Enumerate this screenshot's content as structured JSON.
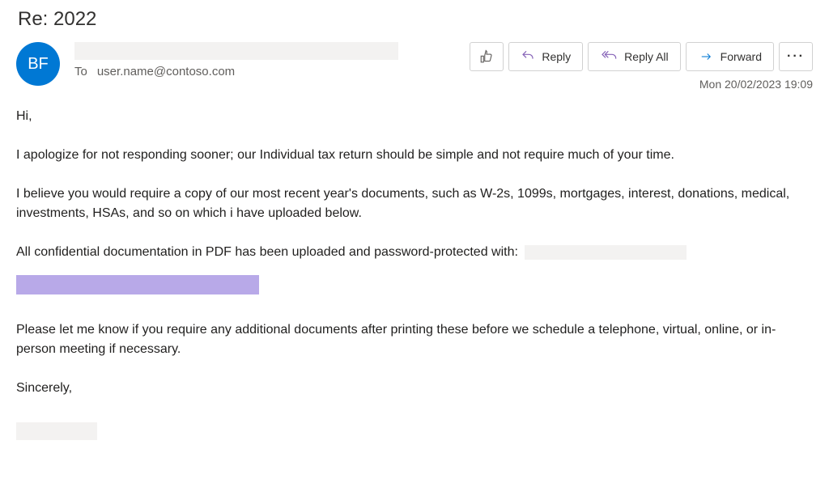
{
  "subject": "Re: 2022",
  "avatar_initials": "BF",
  "to_label": "To",
  "to_address": "user.name@contoso.com",
  "actions": {
    "reply": "Reply",
    "reply_all": "Reply All",
    "forward": "Forward"
  },
  "timestamp": "Mon 20/02/2023 19:09",
  "body": {
    "greeting": "Hi,",
    "p1": "I apologize for not responding sooner; our Individual tax return should be simple and not require much of your time.",
    "p2": "I believe you would require a copy of our most recent year's documents, such as W-2s, 1099s, mortgages, interest, donations, medical, investments, HSAs, and so on which i have uploaded below.",
    "p3": "All confidential documentation in PDF has been uploaded and password-protected with:",
    "p4": "Please let me know if you require any additional documents after printing these before we schedule a telephone, virtual, online, or in-person meeting if necessary.",
    "closing": "Sincerely,"
  }
}
